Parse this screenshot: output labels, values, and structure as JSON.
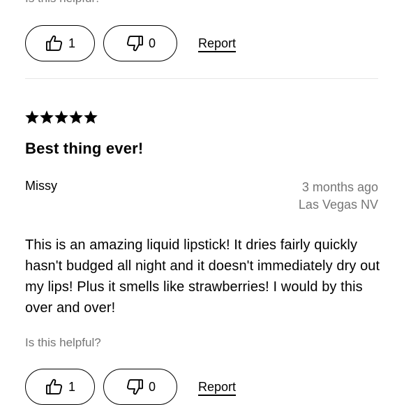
{
  "previous_review": {
    "helpful_prompt": "Is this helpful?",
    "upvote_count": "1",
    "downvote_count": "0",
    "report_label": "Report"
  },
  "review": {
    "rating": 5,
    "rating_max": 5,
    "title": "Best thing ever!",
    "author": "Missy",
    "time_ago": "3 months ago",
    "location": "Las Vegas NV",
    "body": "This is an amazing liquid lipstick! It dries fairly quickly hasn't budged all night and it doesn't immediately dry out my lips! Plus it smells like strawberries! I would by this over and over!",
    "helpful_prompt": "Is this helpful?",
    "upvote_count": "1",
    "downvote_count": "0",
    "report_label": "Report"
  },
  "colors": {
    "text": "#000000",
    "muted": "#757575",
    "divider": "#e6e6e6",
    "background": "#ffffff"
  },
  "icons": [
    "thumbs-up-icon",
    "thumbs-down-icon",
    "star-icon"
  ]
}
